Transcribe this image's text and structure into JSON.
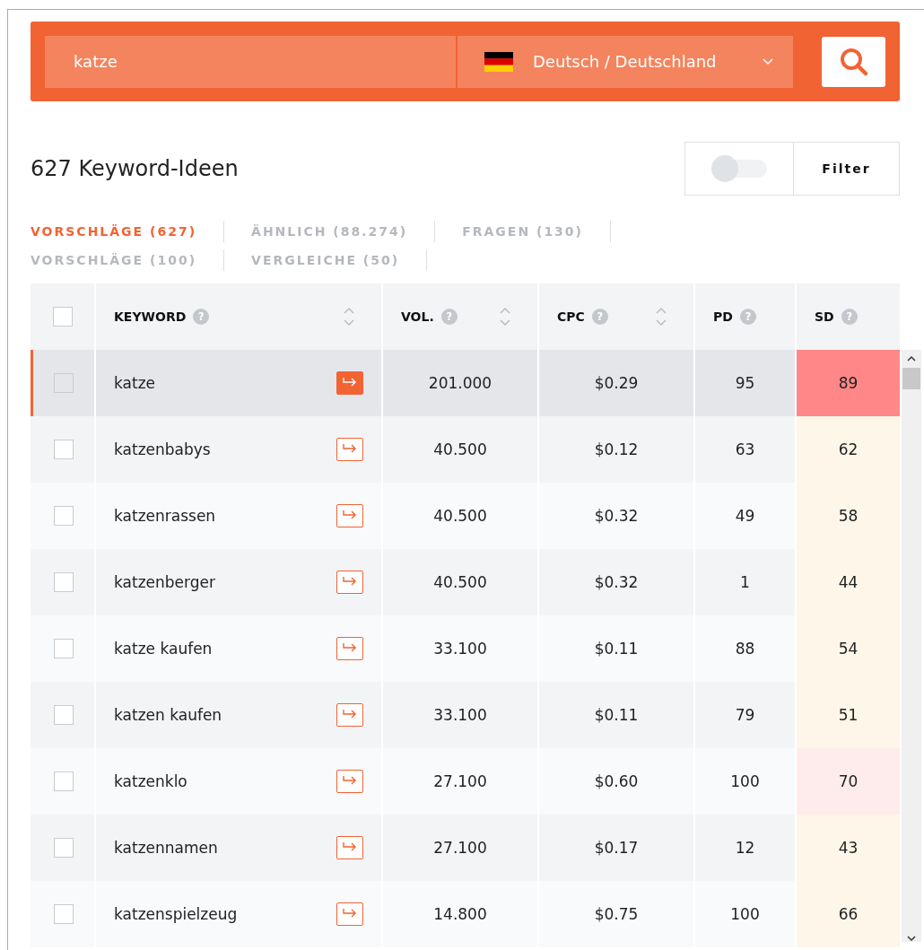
{
  "search": {
    "value": "katze",
    "language": "Deutsch / Deutschland"
  },
  "results_title": "627 Keyword-Ideen",
  "filter": {
    "on": false,
    "label": "Filter"
  },
  "tabs": [
    {
      "label": "VORSCHLÄGE (627)",
      "selected": true
    },
    {
      "label": "ÄHNLICH (88.274)",
      "selected": false
    },
    {
      "label": "FRAGEN (130)",
      "selected": false
    },
    {
      "label": "VORSCHLÄGE (100)",
      "selected": false
    },
    {
      "label": "VERGLEICHE (50)",
      "selected": false
    }
  ],
  "table": {
    "select_all_checked": false,
    "columns": [
      {
        "label": "KEYWORD",
        "help": "?",
        "sortable": true
      },
      {
        "label": "VOL.",
        "help": "?",
        "sortable": true
      },
      {
        "label": "CPC",
        "help": "?",
        "sortable": true
      },
      {
        "label": "PD",
        "help": "?",
        "sortable": false
      },
      {
        "label": "SD",
        "help": "?",
        "sortable": false
      }
    ],
    "rows": [
      {
        "keyword": "katze",
        "volume": "201.000",
        "cpc": "$0.29",
        "pd": "95",
        "sd": "89",
        "color": "#ff8787",
        "selected": true,
        "checked": false
      },
      {
        "keyword": "katzenbabys",
        "volume": "40.500",
        "cpc": "$0.12",
        "pd": "63",
        "sd": "62",
        "color": "#fef6e8",
        "selected": false,
        "checked": false
      },
      {
        "keyword": "katzenrassen",
        "volume": "40.500",
        "cpc": "$0.32",
        "pd": "49",
        "sd": "58",
        "color": "#fef6e8",
        "selected": false,
        "checked": false
      },
      {
        "keyword": "katzenberger",
        "volume": "40.500",
        "cpc": "$0.32",
        "pd": "1",
        "sd": "44",
        "color": "#fef6e8",
        "selected": false,
        "checked": false
      },
      {
        "keyword": "katze kaufen",
        "volume": "33.100",
        "cpc": "$0.11",
        "pd": "88",
        "sd": "54",
        "color": "#fef6e8",
        "selected": false,
        "checked": false
      },
      {
        "keyword": "katzen kaufen",
        "volume": "33.100",
        "cpc": "$0.11",
        "pd": "79",
        "sd": "51",
        "color": "#fef6e8",
        "selected": false,
        "checked": false
      },
      {
        "keyword": "katzenklo",
        "volume": "27.100",
        "cpc": "$0.60",
        "pd": "100",
        "sd": "70",
        "color": "#feecec",
        "selected": false,
        "checked": false
      },
      {
        "keyword": "katzennamen",
        "volume": "27.100",
        "cpc": "$0.17",
        "pd": "12",
        "sd": "43",
        "color": "#fef6e8",
        "selected": false,
        "checked": false
      },
      {
        "keyword": "katzenspielzeug",
        "volume": "14.800",
        "cpc": "$0.75",
        "pd": "100",
        "sd": "66",
        "color": "#fef6e8",
        "selected": false,
        "checked": false
      }
    ]
  }
}
